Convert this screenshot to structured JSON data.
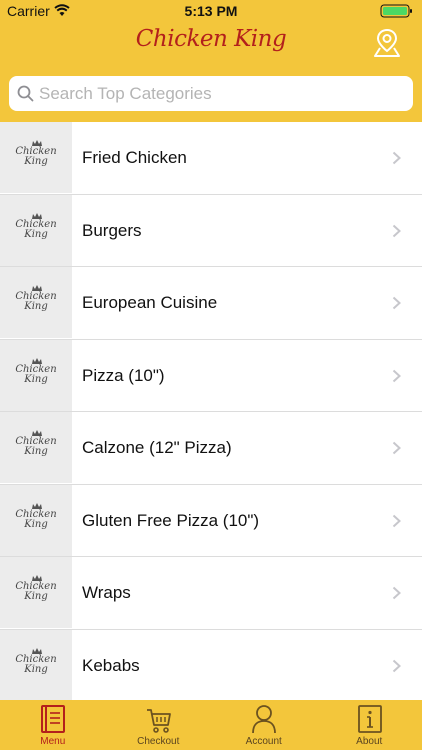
{
  "status_bar": {
    "carrier": "Carrier",
    "time": "5:13 PM"
  },
  "header": {
    "brand": "Chicken King"
  },
  "search": {
    "placeholder": "Search Top Categories"
  },
  "thumb_logo": {
    "line1": "Chicken",
    "line2": "King"
  },
  "categories": [
    {
      "label": "Fried Chicken"
    },
    {
      "label": "Burgers"
    },
    {
      "label": "European Cuisine"
    },
    {
      "label": "Pizza (10\")"
    },
    {
      "label": "Calzone (12\" Pizza)"
    },
    {
      "label": "Gluten Free Pizza (10\")"
    },
    {
      "label": "Wraps"
    },
    {
      "label": "Kebabs"
    }
  ],
  "tabs": [
    {
      "label": "Menu",
      "icon": "menu-book-icon",
      "active": true
    },
    {
      "label": "Checkout",
      "icon": "cart-icon",
      "active": false
    },
    {
      "label": "Account",
      "icon": "person-icon",
      "active": false
    },
    {
      "label": "About",
      "icon": "info-icon",
      "active": false
    }
  ],
  "colors": {
    "accent": "#f3c63b",
    "brand_red": "#b3201c",
    "tab_icon": "#6b5220",
    "battery_green": "#4cd964"
  }
}
